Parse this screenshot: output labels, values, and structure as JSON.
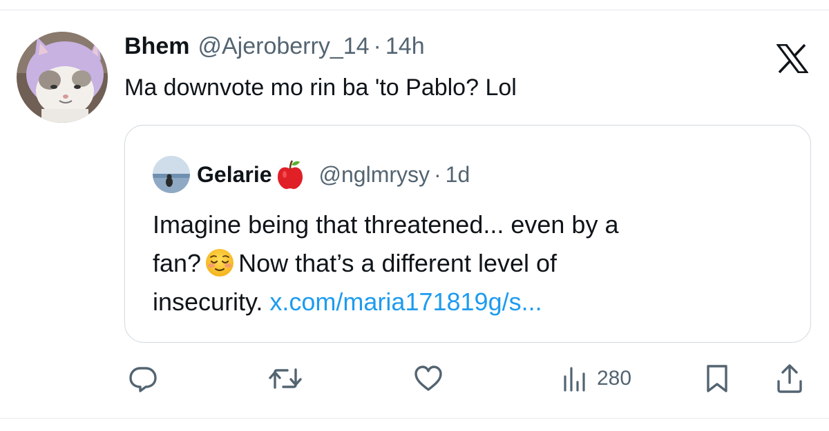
{
  "tweet": {
    "author_name": "Bhem",
    "author_handle": "@Ajeroberry_14",
    "separator": "·",
    "time": "14h",
    "text": "Ma downvote mo rin ba 'to Pablo? Lol"
  },
  "quote": {
    "author_name": "Gelarie",
    "author_emoji": "red-apple-emoji",
    "author_handle": "@nglmrysy",
    "separator": "·",
    "time": "1d",
    "line1": "Imagine being that threatened... even by a",
    "line2_before": "fan?",
    "line2_emoji": "relieved-face-emoji",
    "line2_after": "Now that’s a different level of",
    "line3_text": "insecurity.",
    "link": "x.com/maria171819g/s..."
  },
  "actions": {
    "views": "280",
    "icons": [
      "reply-icon",
      "retweet-icon",
      "like-icon",
      "views-icon",
      "bookmark-icon",
      "share-icon"
    ]
  },
  "colors": {
    "text": "#0f1419",
    "secondary": "#536471",
    "link": "#1d9bf0",
    "border": "#cfd9de"
  }
}
